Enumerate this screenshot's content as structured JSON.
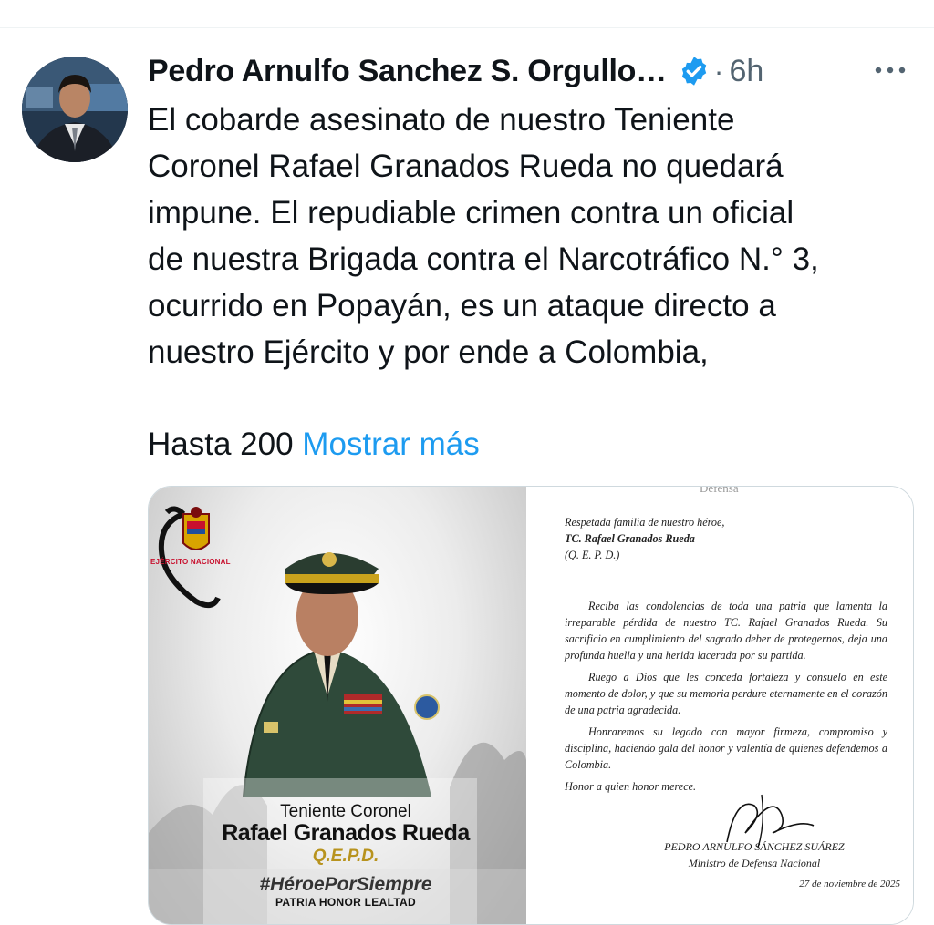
{
  "post": {
    "author": "Pedro Arnulfo Sanchez S. Orgullo…",
    "separator": "·",
    "time": "6h",
    "text_main": "El cobarde asesinato de nuestro Teniente\nCoronel Rafael Granados Rueda no quedará\nimpune. El repudiable crimen contra un oficial\nde nuestra Brigada contra el Narcotráfico N.° 3,\nocurrido en Popayán, es un ataque directo a\nnuestro Ejército y por ende a Colombia,",
    "text_tail": "Hasta 200",
    "show_more": "Mostrar más"
  },
  "icons": {
    "verified": "verified-badge-icon",
    "more": "more-options-icon",
    "mourning": "mourning-ribbon-icon"
  },
  "colors": {
    "link": "#1d9bf0",
    "verified": "#1d9bf0",
    "muted": "#536471",
    "gold": "#b8931e"
  },
  "media_left": {
    "emblem_label": "EJÉRCITO NACIONAL",
    "rank": "Teniente Coronel",
    "name": "Rafael Granados Rueda",
    "qepd": "Q.E.P.D.",
    "hashtag": "#HéroePorSiempre",
    "motto": "PATRIA HONOR LEALTAD"
  },
  "media_right": {
    "header_fragment": "Defensa",
    "salutation": "Respetada familia de nuestro héroe,",
    "honoree": "TC. Rafael Granados Rueda",
    "rip": "(Q. E. P. D.)",
    "p1": "Reciba las condolencias de toda una patria que lamenta la irreparable pérdida de nuestro TC. Rafael Granados Rueda. Su sacrificio en cumplimiento del sagrado deber de protegernos, deja una profunda huella y una herida lacerada por su partida.",
    "p2": "Ruego a Dios que les conceda fortaleza y consuelo en este momento de dolor, y que su memoria perdure eternamente en el corazón de una patria agradecida.",
    "p3": "Honraremos su legado con mayor firmeza, compromiso y disciplina, haciendo gala del honor y valentía de quienes defendemos a Colombia.",
    "closing": "Honor a quien honor merece.",
    "signer": "PEDRO ARNULFO SÁNCHEZ SUÁREZ",
    "signer_title": "Ministro de Defensa Nacional",
    "date": "27 de noviembre de 2025"
  }
}
